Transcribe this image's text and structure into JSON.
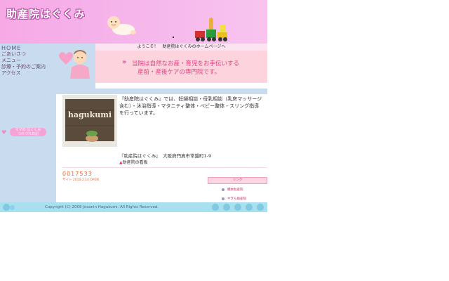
{
  "site": {
    "logo": "助産院はぐくみ"
  },
  "nav": {
    "items": [
      "HOME",
      "ごあいさつ",
      "メニュー",
      "診療・予約のご案内",
      "アクセス"
    ],
    "diary_label": "ママの はぐくみ\nつれづれ日記"
  },
  "welcome": "ようこそ！　助産院はぐくみのホームページへ",
  "banner": {
    "line1": "当院は自然なお産・育児をお手伝いする",
    "line2": "産前・産後ケアの専門院です。"
  },
  "sign": {
    "text": "hagukumi"
  },
  "description": "『助産院はぐくみ』では、妊婦相談・母乳相談（乳房マッサージ含む）・沐浴指導・マタニティ整体・ベビー整体・スリング指導を行っています。",
  "address": "『助産院はぐくみ』　大阪府門真市常盤町1-9",
  "caption": "助産院の看板",
  "counter": {
    "value": "0017533",
    "since": "サイト 2010.2.14 OPEN"
  },
  "links": {
    "header": "リンク",
    "items": [
      "橋本助産院",
      "やぎら助産院"
    ]
  },
  "footer": "Copyright (C) 2008 Josanin Hagukumi. All Rights Reserved.",
  "colors": {
    "header_pink": "#f7a9e6",
    "sidebar_blue": "#c9dcef",
    "banner_pink": "#fdd3dd",
    "accent": "#e0407f",
    "footer_cyan": "#a8e0ef"
  }
}
